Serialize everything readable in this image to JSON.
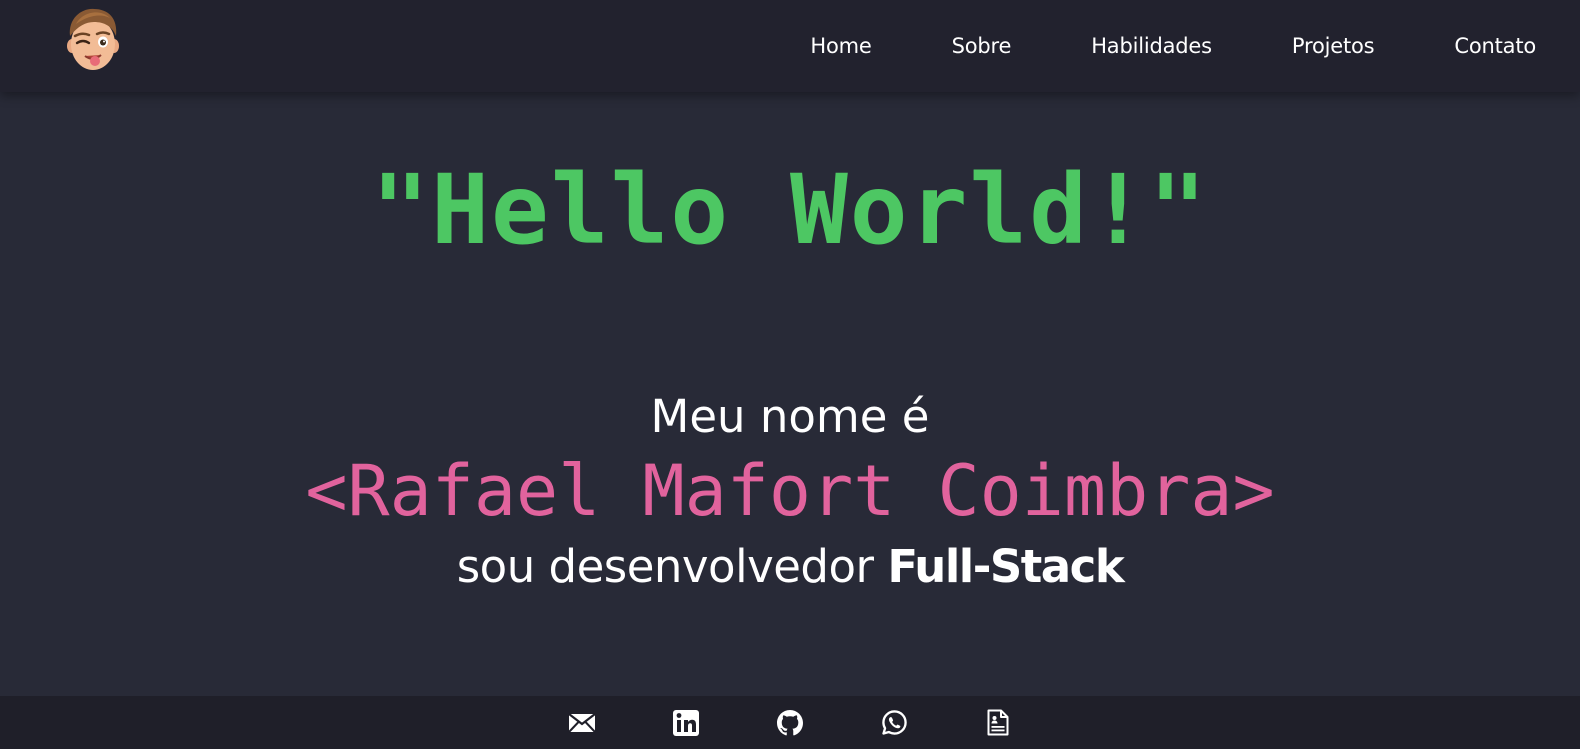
{
  "header": {
    "avatar_icon": "winking-memoji-avatar-icon",
    "nav": [
      {
        "label": "Home"
      },
      {
        "label": "Sobre"
      },
      {
        "label": "Habilidades"
      },
      {
        "label": "Projetos"
      },
      {
        "label": "Contato"
      }
    ]
  },
  "hero": {
    "greeting": "\"Hello World!\"",
    "intro": "Meu nome é",
    "name": "<Rafael Mafort Coimbra>",
    "role_prefix": "sou desenvolvedor ",
    "role_highlight": "Full-Stack"
  },
  "footer": {
    "social_icons": [
      "email-icon",
      "linkedin-icon",
      "github-icon",
      "whatsapp-icon",
      "resume-document-icon"
    ]
  },
  "colors": {
    "background": "#282a36",
    "header_background": "#22222e",
    "footer_background": "#1f1f29",
    "greeting": "#4dc763",
    "name": "#e1639d",
    "text": "#ffffff"
  }
}
